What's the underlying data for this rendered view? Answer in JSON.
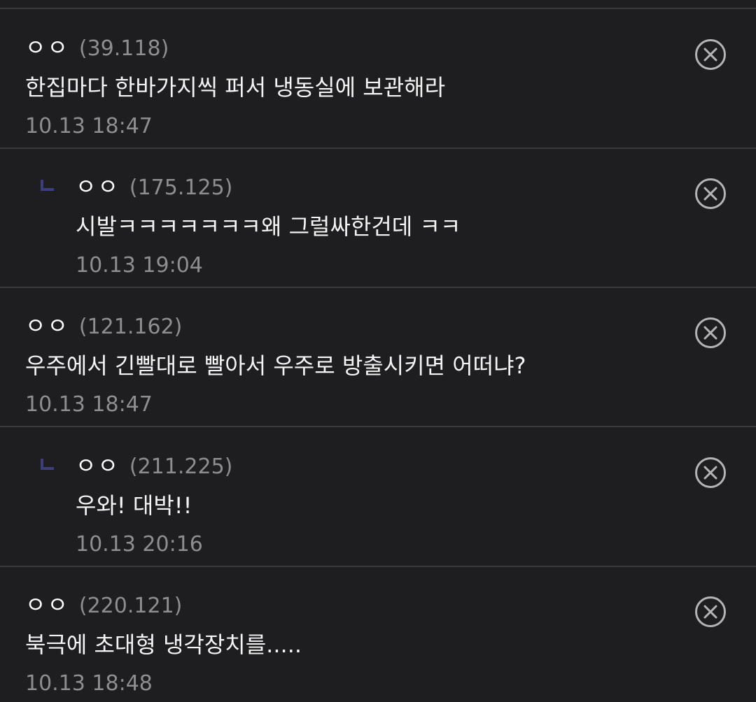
{
  "comments": [
    {
      "nick": "ㅇㅇ",
      "ip": "(39.118)",
      "text": "한집마다 한바가지씩 퍼서 냉동실에 보관해라",
      "time": "10.13 18:47",
      "reply": false
    },
    {
      "nick": "ㅇㅇ",
      "ip": "(175.125)",
      "text": "시발ㅋㅋㅋㅋㅋㅋㅋ왜 그럴싸한건데 ㅋㅋ",
      "time": "10.13 19:04",
      "reply": true
    },
    {
      "nick": "ㅇㅇ",
      "ip": "(121.162)",
      "text": "우주에서 긴빨대로 빨아서 우주로 방출시키면 어떠냐?",
      "time": "10.13 18:47",
      "reply": false
    },
    {
      "nick": "ㅇㅇ",
      "ip": "(211.225)",
      "text": "우와! 대박!!",
      "time": "10.13 20:16",
      "reply": true
    },
    {
      "nick": "ㅇㅇ",
      "ip": "(220.121)",
      "text": "북극에 초대형 냉각장치를.....",
      "time": "10.13 18:48",
      "reply": false
    }
  ],
  "icons": {
    "delete": "close-circle-icon",
    "reply": "reply-indicator-icon"
  },
  "colors": {
    "background": "#1e1e20",
    "divider": "#3a3a3c",
    "meta": "#8e8e92",
    "reply_mark": "#3d3f7a"
  }
}
